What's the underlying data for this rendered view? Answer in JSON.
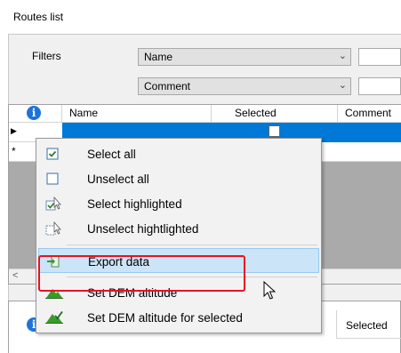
{
  "window": {
    "title": "Routes list"
  },
  "filters": {
    "label": "Filters",
    "rows": [
      {
        "field": "Name"
      },
      {
        "field": "Comment"
      }
    ]
  },
  "grid": {
    "headers": {
      "name": "Name",
      "selected": "Selected",
      "comment": "Comment"
    },
    "info_glyph": "i",
    "row1_text": "",
    "new_row_marker": "*",
    "current_row_marker": "▶"
  },
  "grid2": {
    "headers": {
      "selected": "Selected"
    }
  },
  "context_menu": {
    "items": [
      {
        "label": "Select all",
        "icon": "checkbox-checked-icon"
      },
      {
        "label": "Unselect all",
        "icon": "checkbox-unchecked-icon"
      },
      {
        "label": "Select highlighted",
        "icon": "select-highlighted-icon"
      },
      {
        "label": "Unselect hightlighted",
        "icon": "unselect-highlighted-icon"
      },
      {
        "label": "Export data",
        "icon": "export-icon"
      },
      {
        "label": "Set DEM altitude",
        "icon": "mountain-icon"
      },
      {
        "label": "Set DEM altitude for selected",
        "icon": "mountain-check-icon"
      }
    ],
    "highlighted_item": "Export data"
  },
  "colors": {
    "selection": "#0078d7",
    "menu_highlight": "#cce4f7",
    "annotation": "#e81123",
    "info_icon": "#1e73d8",
    "mountain_green": "#3a9a2a"
  }
}
